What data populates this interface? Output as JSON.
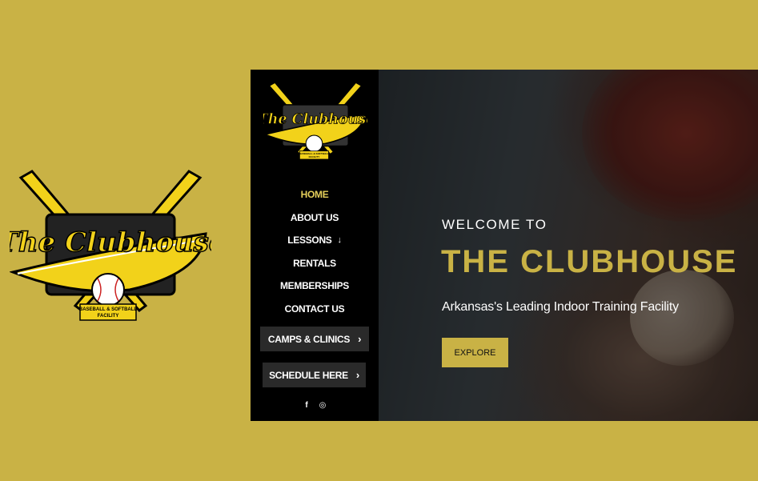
{
  "logo": {
    "word": "The Clubhouse",
    "tagline_line1": "BASEBALL & SOFTBALL",
    "tagline_line2": "FACILITY"
  },
  "nav": {
    "items": [
      {
        "label": "HOME",
        "active": true
      },
      {
        "label": "ABOUT US",
        "active": false
      },
      {
        "label": "LESSONS",
        "active": false,
        "has_submenu": true
      },
      {
        "label": "RENTALS",
        "active": false
      },
      {
        "label": "MEMBERSHIPS",
        "active": false
      },
      {
        "label": "CONTACT US",
        "active": false
      }
    ],
    "submenu_arrow": "↓"
  },
  "buttons": {
    "camps": "CAMPS & CLINICS",
    "schedule": "SCHEDULE HERE",
    "chevron": "›"
  },
  "social": {
    "facebook": "f",
    "instagram": "◎"
  },
  "hero": {
    "welcome": "WELCOME TO",
    "title": "THE CLUBHOUSE",
    "subtitle": "Arkansas's Leading Indoor Training Facility",
    "cta": "EXPLORE"
  },
  "colors": {
    "background": "#c9b245",
    "accent": "#c9b245",
    "active_nav": "#e5cf5a",
    "sidebar": "#000000",
    "button_bg": "#2a2a2a",
    "logo_yellow": "#f2d21a"
  },
  "icons": [
    "baseball-bat-icon",
    "baseball-icon",
    "facebook-icon",
    "instagram-icon",
    "chevron-right-icon",
    "arrow-down-icon"
  ]
}
